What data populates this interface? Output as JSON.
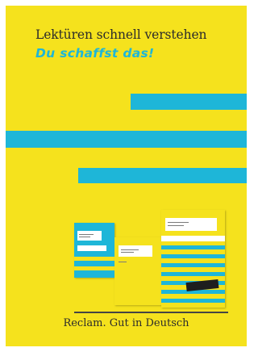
{
  "cover": {
    "title": "Lektüren schnell verstehen",
    "subtitle": "Du schaffst das!",
    "footer": "Reclam. Gut in Deutsch"
  },
  "colors": {
    "background": "#f5e21d",
    "accent": "#1eb6d8",
    "text": "#2b2b2b"
  }
}
